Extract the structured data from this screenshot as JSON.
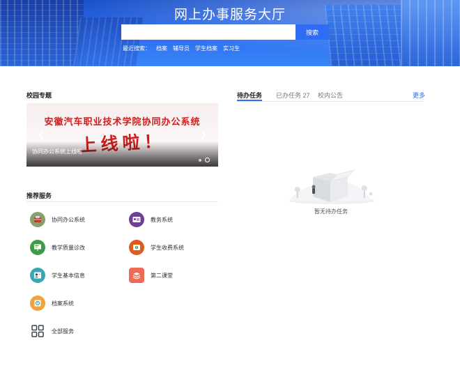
{
  "header": {
    "title": "网上办事服务大厅",
    "search": {
      "value": "",
      "placeholder": "",
      "button_label": "搜索"
    },
    "recent": {
      "label": "最近搜索：",
      "keywords": [
        "档案",
        "辅导员",
        "学生档案",
        "实习生"
      ]
    }
  },
  "campus_topics": {
    "title": "校园专题",
    "slide": {
      "headline": "安徽汽车职业技术学院协同办公系统",
      "slogan": "上线啦！",
      "caption": "协同办公系统上线啦"
    },
    "slides_count": 2
  },
  "recommended_services": {
    "title": "推荐服务",
    "items": [
      {
        "label": "协同办公系统",
        "icon": "briefcase-icon",
        "color": "#8aa06a"
      },
      {
        "label": "教务系统",
        "icon": "id-card-icon",
        "color": "#6d3f97"
      },
      {
        "label": "教学质量诊改",
        "icon": "presentation-icon",
        "color": "#3f9a4a"
      },
      {
        "label": "学生收费系统",
        "icon": "payment-icon",
        "color": "#e05a1e"
      },
      {
        "label": "学生基本信息",
        "icon": "user-info-icon",
        "color": "#3aa7b4"
      },
      {
        "label": "第二课堂",
        "icon": "book-icon",
        "color": "#ee6a55"
      },
      {
        "label": "档案系统",
        "icon": "archive-icon",
        "color": "#f0a23c"
      },
      {
        "label": "全部服务",
        "icon": "grid-icon",
        "color": "#3b4350"
      }
    ]
  },
  "tasks": {
    "tabs": [
      {
        "label": "待办任务",
        "active": true
      },
      {
        "label": "已办任务 27",
        "active": false
      },
      {
        "label": "校内公告",
        "active": false
      }
    ],
    "more_label": "更多",
    "empty_text": "暂无待办任务"
  },
  "colors": {
    "accent": "#2f6cf6",
    "banner": "#2a66e6"
  }
}
